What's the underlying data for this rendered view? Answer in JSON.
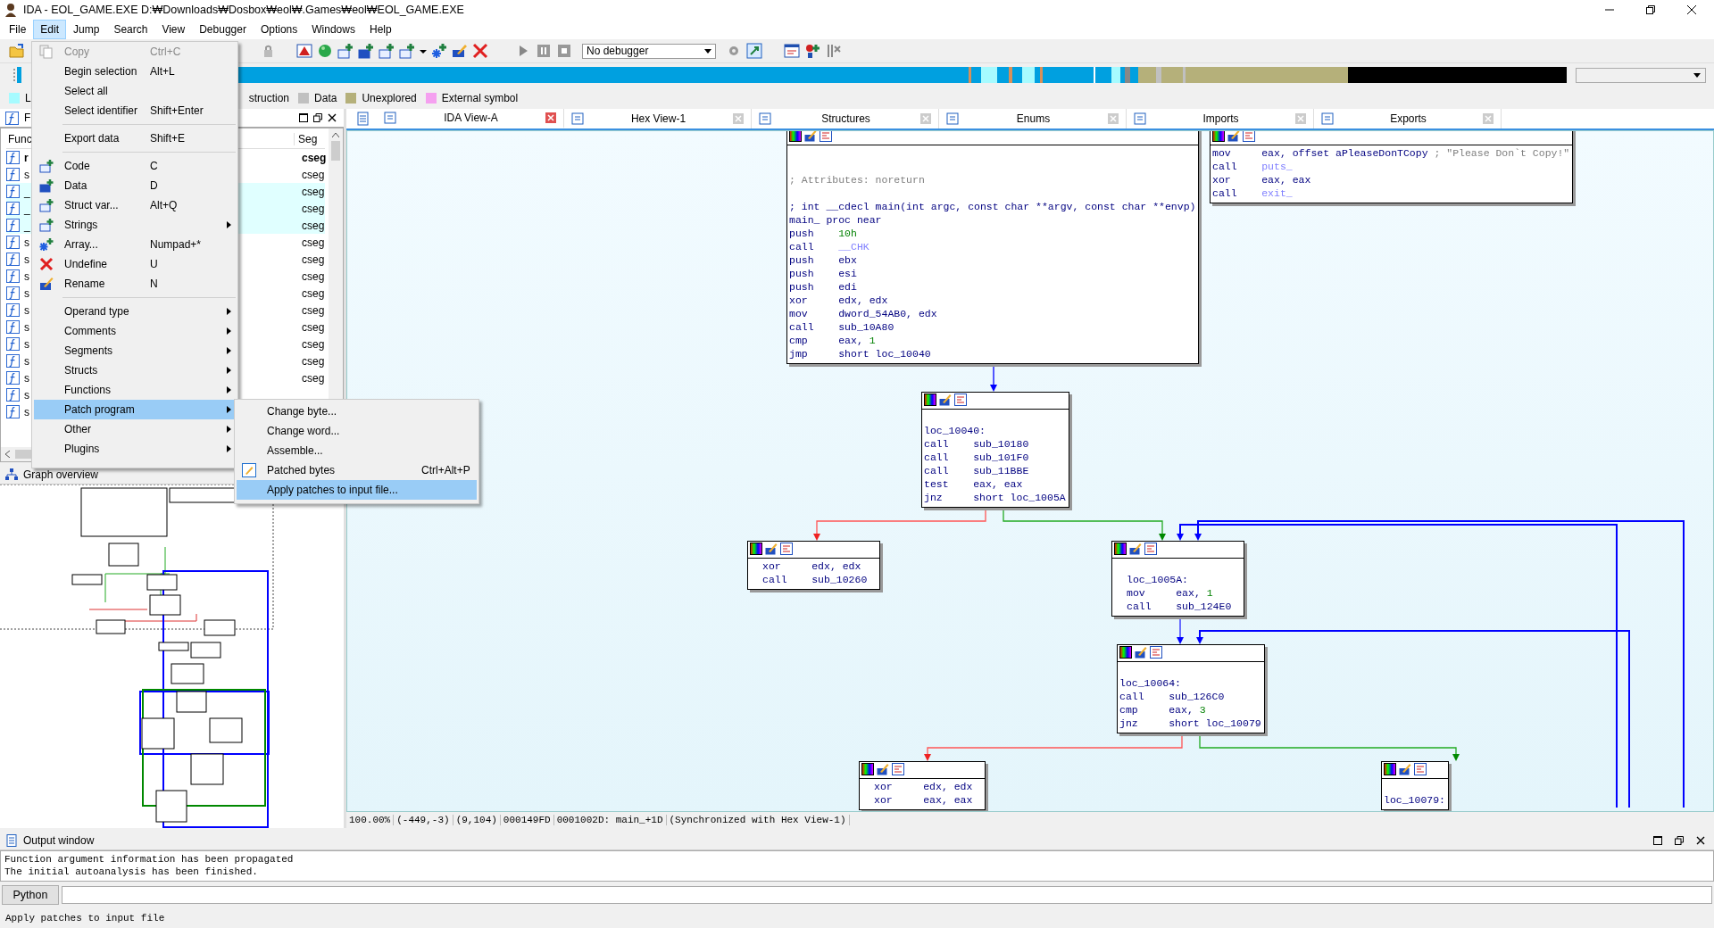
{
  "window": {
    "title": "IDA - EOL_GAME.EXE D:₩Downloads₩Dosbox₩eol₩.Games₩eol₩EOL_GAME.EXE"
  },
  "menu_bar": [
    {
      "label": "File",
      "selected": false
    },
    {
      "label": "Edit",
      "selected": true
    },
    {
      "label": "Jump",
      "selected": false
    },
    {
      "label": "Search",
      "selected": false
    },
    {
      "label": "View",
      "selected": false
    },
    {
      "label": "Debugger",
      "selected": false
    },
    {
      "label": "Options",
      "selected": false
    },
    {
      "label": "Windows",
      "selected": false
    },
    {
      "label": "Help",
      "selected": false
    }
  ],
  "toolbar": {
    "debugger_select": "No debugger"
  },
  "legend": [
    {
      "label": "L",
      "color": "#a6fbff"
    },
    {
      "label": "struction"
    },
    {
      "label": "Data",
      "color": "#c0c0c0"
    },
    {
      "label": "Unexplored",
      "color": "#b5b07a"
    },
    {
      "label": "External symbol",
      "color": "#f5a0f0"
    }
  ],
  "functions_window": {
    "title": "F",
    "columns": [
      "Func",
      "Seg"
    ],
    "rows": [
      {
        "name": "r",
        "segment": "cseg",
        "current": true,
        "library": false
      },
      {
        "name": "s",
        "segment": "cseg",
        "current": false,
        "library": false
      },
      {
        "name": "_",
        "segment": "cseg",
        "current": false,
        "library": true
      },
      {
        "name": "_",
        "segment": "cseg",
        "current": false,
        "library": true
      },
      {
        "name": "_",
        "segment": "cseg",
        "current": false,
        "library": true
      },
      {
        "name": "s",
        "segment": "cseg",
        "current": false,
        "library": false
      },
      {
        "name": "s",
        "segment": "cseg",
        "current": false,
        "library": false
      },
      {
        "name": "s",
        "segment": "cseg",
        "current": false,
        "library": false
      },
      {
        "name": "s",
        "segment": "cseg",
        "current": false,
        "library": false
      },
      {
        "name": "s",
        "segment": "cseg",
        "current": false,
        "library": false
      },
      {
        "name": "s",
        "segment": "cseg",
        "current": false,
        "library": false
      },
      {
        "name": "s",
        "segment": "cseg",
        "current": false,
        "library": false
      },
      {
        "name": "s",
        "segment": "cseg",
        "current": false,
        "library": false
      },
      {
        "name": "s",
        "segment": "cseg",
        "current": false,
        "library": false
      },
      {
        "name": "s",
        "current": false,
        "library": false
      },
      {
        "name": "s",
        "current": false,
        "library": false
      }
    ]
  },
  "graph_overview": {
    "title": "Graph overview"
  },
  "tabs": [
    {
      "label": "IDA View-A",
      "selected": true
    },
    {
      "label": "Hex View-1",
      "selected": false
    },
    {
      "label": "Structures",
      "selected": false
    },
    {
      "label": "Enums",
      "selected": false
    },
    {
      "label": "Imports",
      "selected": false
    },
    {
      "label": "Exports",
      "selected": false
    }
  ],
  "edit_menu": [
    {
      "kind": "item",
      "label": "Copy",
      "shortcut": "Ctrl+C",
      "disabled": true,
      "submenu": false,
      "selected": false
    },
    {
      "kind": "item",
      "label": "Begin selection",
      "shortcut": "Alt+L",
      "disabled": false,
      "submenu": false,
      "selected": false
    },
    {
      "kind": "item",
      "label": "Select all",
      "disabled": false,
      "submenu": false,
      "selected": false
    },
    {
      "kind": "item",
      "label": "Select identifier",
      "shortcut": "Shift+Enter",
      "disabled": false,
      "submenu": false,
      "selected": false
    },
    {
      "kind": "separator"
    },
    {
      "kind": "item",
      "label": "Export data",
      "shortcut": "Shift+E",
      "disabled": false,
      "submenu": false,
      "selected": false
    },
    {
      "kind": "separator"
    },
    {
      "kind": "item",
      "label": "Code",
      "shortcut": "C",
      "disabled": false,
      "submenu": false,
      "selected": false
    },
    {
      "kind": "item",
      "label": "Data",
      "shortcut": "D",
      "disabled": false,
      "submenu": false,
      "selected": false
    },
    {
      "kind": "item",
      "label": "Struct var...",
      "shortcut": "Alt+Q",
      "disabled": false,
      "submenu": false,
      "selected": false
    },
    {
      "kind": "item",
      "label": "Strings",
      "disabled": false,
      "submenu": true,
      "selected": false
    },
    {
      "kind": "item",
      "label": "Array...",
      "shortcut": "Numpad+*",
      "disabled": false,
      "submenu": false,
      "selected": false
    },
    {
      "kind": "item",
      "label": "Undefine",
      "shortcut": "U",
      "disabled": false,
      "submenu": false,
      "selected": false
    },
    {
      "kind": "item",
      "label": "Rename",
      "shortcut": "N",
      "disabled": false,
      "submenu": false,
      "selected": false
    },
    {
      "kind": "separator"
    },
    {
      "kind": "item",
      "label": "Operand type",
      "disabled": false,
      "submenu": true,
      "selected": false
    },
    {
      "kind": "item",
      "label": "Comments",
      "disabled": false,
      "submenu": true,
      "selected": false
    },
    {
      "kind": "item",
      "label": "Segments",
      "disabled": false,
      "submenu": true,
      "selected": false
    },
    {
      "kind": "item",
      "label": "Structs",
      "disabled": false,
      "submenu": true,
      "selected": false
    },
    {
      "kind": "item",
      "label": "Functions",
      "disabled": false,
      "submenu": true,
      "selected": false
    },
    {
      "kind": "item",
      "label": "Patch program",
      "disabled": false,
      "submenu": true,
      "selected": true
    },
    {
      "kind": "item",
      "label": "Other",
      "disabled": false,
      "submenu": true,
      "selected": false
    },
    {
      "kind": "item",
      "label": "Plugins",
      "disabled": false,
      "submenu": true,
      "selected": false
    }
  ],
  "patch_submenu": [
    {
      "label": "Change byte...",
      "selected": false
    },
    {
      "label": "Change word...",
      "selected": false
    },
    {
      "label": "Assemble...",
      "selected": false
    },
    {
      "label": "Patched bytes",
      "shortcut": "Ctrl+Alt+P",
      "selected": false
    },
    {
      "label": "Apply patches to input file...",
      "selected": true
    }
  ],
  "graph": {
    "nodes": [
      {
        "lines": [
          {
            "kind": "blank"
          },
          {
            "kind": "blank"
          },
          {
            "kind": "comment",
            "text": "; Attributes: noreturn"
          },
          {
            "kind": "blank"
          },
          {
            "kind": "label",
            "text": "; int __cdecl main(int argc, const char **argv, const char **envp)"
          },
          {
            "kind": "label",
            "text": "main_ proc near"
          },
          {
            "kind": "code",
            "op": "push",
            "args": [
              {
                "text": "10h",
                "kind": "number"
              }
            ]
          },
          {
            "kind": "code",
            "op": "call",
            "args": [
              {
                "text": "__CHK",
                "kind": "extern"
              }
            ]
          },
          {
            "kind": "code",
            "op": "push",
            "args": [
              {
                "text": "ebx",
                "kind": "operand"
              }
            ]
          },
          {
            "kind": "code",
            "op": "push",
            "args": [
              {
                "text": "esi",
                "kind": "operand"
              }
            ]
          },
          {
            "kind": "code",
            "op": "push",
            "args": [
              {
                "text": "edi",
                "kind": "operand"
              }
            ]
          },
          {
            "kind": "code",
            "op": "xor",
            "args": [
              {
                "text": "edx, edx",
                "kind": "operand"
              }
            ]
          },
          {
            "kind": "code",
            "op": "mov",
            "args": [
              {
                "text": "dword_54AB0, edx",
                "kind": "operand"
              }
            ]
          },
          {
            "kind": "code",
            "op": "call",
            "args": [
              {
                "text": "sub_10A80",
                "kind": "operand"
              }
            ]
          },
          {
            "kind": "code",
            "op": "cmp",
            "args": [
              {
                "text": "eax, ",
                "kind": "operand"
              },
              {
                "text": "1",
                "kind": "number"
              }
            ]
          },
          {
            "kind": "code",
            "op": "jmp",
            "args": [
              {
                "text": "short loc_10040",
                "kind": "operand"
              }
            ]
          }
        ]
      },
      {
        "lines": [
          {
            "kind": "code",
            "op": "mov",
            "args": [
              {
                "text": "eax, offset aPleaseDonTCopy",
                "kind": "operand"
              },
              {
                "text": " ; \"Please Don`t Copy!\"",
                "kind": "comment"
              }
            ]
          },
          {
            "kind": "code",
            "op": "call",
            "args": [
              {
                "text": "puts_",
                "kind": "extern"
              }
            ]
          },
          {
            "kind": "code",
            "op": "xor",
            "args": [
              {
                "text": "eax, eax",
                "kind": "operand"
              }
            ]
          },
          {
            "kind": "code",
            "op": "call",
            "args": [
              {
                "text": "exit_",
                "kind": "extern"
              }
            ]
          }
        ]
      },
      {
        "lines": [
          {
            "kind": "blank"
          },
          {
            "kind": "label",
            "text": "loc_10040:"
          },
          {
            "kind": "code",
            "op": "call",
            "args": [
              {
                "text": "sub_10180",
                "kind": "operand"
              }
            ]
          },
          {
            "kind": "code",
            "op": "call",
            "args": [
              {
                "text": "sub_101F0",
                "kind": "operand"
              }
            ]
          },
          {
            "kind": "code",
            "op": "call",
            "args": [
              {
                "text": "sub_11BBE",
                "kind": "operand"
              }
            ]
          },
          {
            "kind": "code",
            "op": "test",
            "args": [
              {
                "text": "eax, eax",
                "kind": "operand"
              }
            ]
          },
          {
            "kind": "code",
            "op": "jnz",
            "args": [
              {
                "text": "short loc_1005A",
                "kind": "operand"
              }
            ]
          }
        ]
      },
      {
        "lines": [
          {
            "kind": "code",
            "op": "xor",
            "args": [
              {
                "text": "edx, edx",
                "kind": "operand"
              }
            ]
          },
          {
            "kind": "code",
            "op": "call",
            "args": [
              {
                "text": "sub_10260",
                "kind": "operand"
              }
            ]
          }
        ]
      },
      {
        "lines": [
          {
            "kind": "blank"
          },
          {
            "kind": "label",
            "text": "loc_1005A:"
          },
          {
            "kind": "code",
            "op": "mov",
            "args": [
              {
                "text": "eax, ",
                "kind": "operand"
              },
              {
                "text": "1",
                "kind": "number"
              }
            ]
          },
          {
            "kind": "code",
            "op": "call",
            "args": [
              {
                "text": "sub_124E0",
                "kind": "operand"
              }
            ]
          }
        ]
      },
      {
        "lines": [
          {
            "kind": "blank"
          },
          {
            "kind": "label",
            "text": "loc_10064:"
          },
          {
            "kind": "code",
            "op": "call",
            "args": [
              {
                "text": "sub_126C0",
                "kind": "operand"
              }
            ]
          },
          {
            "kind": "code",
            "op": "cmp",
            "args": [
              {
                "text": "eax, ",
                "kind": "operand"
              },
              {
                "text": "3",
                "kind": "number"
              }
            ]
          },
          {
            "kind": "code",
            "op": "jnz",
            "args": [
              {
                "text": "short loc_10079",
                "kind": "operand"
              }
            ]
          }
        ]
      },
      {
        "lines": [
          {
            "kind": "code",
            "op": "xor",
            "args": [
              {
                "text": "edx, edx",
                "kind": "operand"
              }
            ]
          },
          {
            "kind": "code",
            "op": "xor",
            "args": [
              {
                "text": "eax, eax",
                "kind": "operand"
              }
            ]
          }
        ]
      },
      {
        "lines": [
          {
            "kind": "blank"
          },
          {
            "kind": "label",
            "text": "loc_10079:"
          }
        ]
      }
    ]
  },
  "graph_status": [
    "100.00%",
    "(-449,-3)",
    "(9,104)",
    "000149FD",
    "0001002D: main_+1D",
    "(Synchronized with Hex View-1)"
  ],
  "output_window": {
    "title": "Output window",
    "lines": [
      "Function argument information has been propagated",
      "The initial autoanalysis has been finished."
    ],
    "input_label": "Python"
  },
  "status_bar": "Apply patches to input file"
}
